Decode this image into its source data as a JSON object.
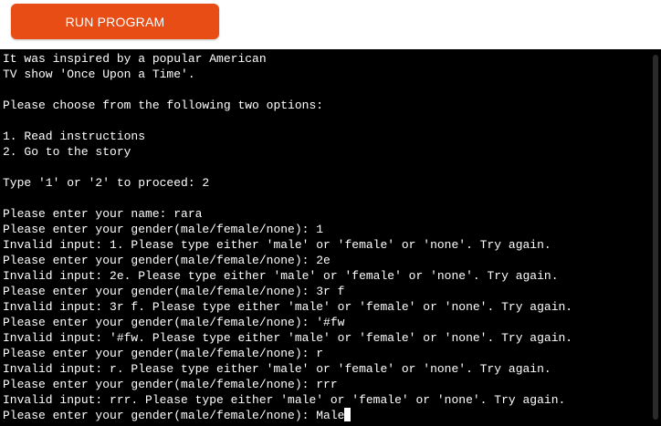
{
  "toolbar": {
    "run_label": "RUN PROGRAM"
  },
  "terminal": {
    "lines": [
      "It was inspired by a popular American",
      "TV show 'Once Upon a Time'.",
      "",
      "Please choose from the following two options:",
      "",
      "1. Read instructions",
      "2. Go to the story",
      "",
      "Type '1' or '2' to proceed: 2",
      "",
      "Please enter your name: rara",
      "Please enter your gender(male/female/none): 1",
      "Invalid input: 1. Please type either 'male' or 'female' or 'none'. Try again.",
      "Please enter your gender(male/female/none): 2e",
      "Invalid input: 2e. Please type either 'male' or 'female' or 'none'. Try again.",
      "Please enter your gender(male/female/none): 3r f",
      "Invalid input: 3r f. Please type either 'male' or 'female' or 'none'. Try again.",
      "Please enter your gender(male/female/none): '#fw",
      "Invalid input: '#fw. Please type either 'male' or 'female' or 'none'. Try again.",
      "Please enter your gender(male/female/none): r",
      "Invalid input: r. Please type either 'male' or 'female' or 'none'. Try again.",
      "Please enter your gender(male/female/none): rrr",
      "Invalid input: rrr. Please type either 'male' or 'female' or 'none'. Try again.",
      "Please enter your gender(male/female/none): Male"
    ]
  },
  "colors": {
    "button_bg": "#e94d16",
    "button_text": "#ffffff",
    "terminal_bg": "#000000",
    "terminal_text": "#ffffff"
  }
}
